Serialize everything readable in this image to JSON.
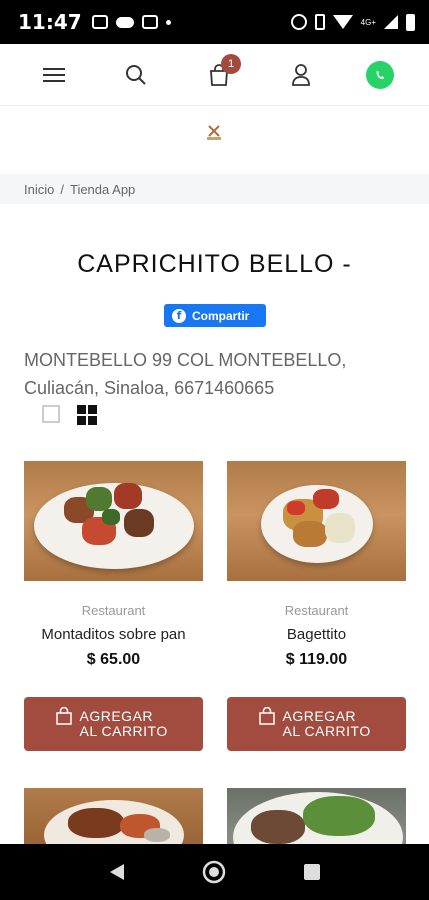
{
  "status_bar": {
    "time": "11:47",
    "network": "4G+"
  },
  "nav": {
    "cart_count": "1"
  },
  "breadcrumb": {
    "home": "Inicio",
    "separator": "/",
    "current": "Tienda App"
  },
  "page": {
    "title": "CAPRICHITO BELLO -",
    "share_label": "Compartir",
    "address": "MONTEBELLO 99 COL MONTEBELLO, Culiacán, Sinaloa, 6671460665"
  },
  "products": [
    {
      "category": "Restaurant",
      "name": "Montaditos sobre pan",
      "price": "$ 65.00",
      "button_label": "AGREGAR AL CARRITO"
    },
    {
      "category": "Restaurant",
      "name": "Bagettito",
      "price": "$ 119.00",
      "button_label": "AGREGAR AL CARRITO"
    }
  ],
  "colors": {
    "accent": "#a24c3f",
    "facebook": "#1877f2",
    "whatsapp": "#25d366"
  },
  "icons": [
    "menu-icon",
    "search-icon",
    "cart-icon",
    "user-icon",
    "whatsapp-icon",
    "facebook-icon",
    "list-view-icon",
    "grid-view-icon",
    "shopping-bag-icon",
    "back-icon",
    "home-icon",
    "recents-icon"
  ]
}
